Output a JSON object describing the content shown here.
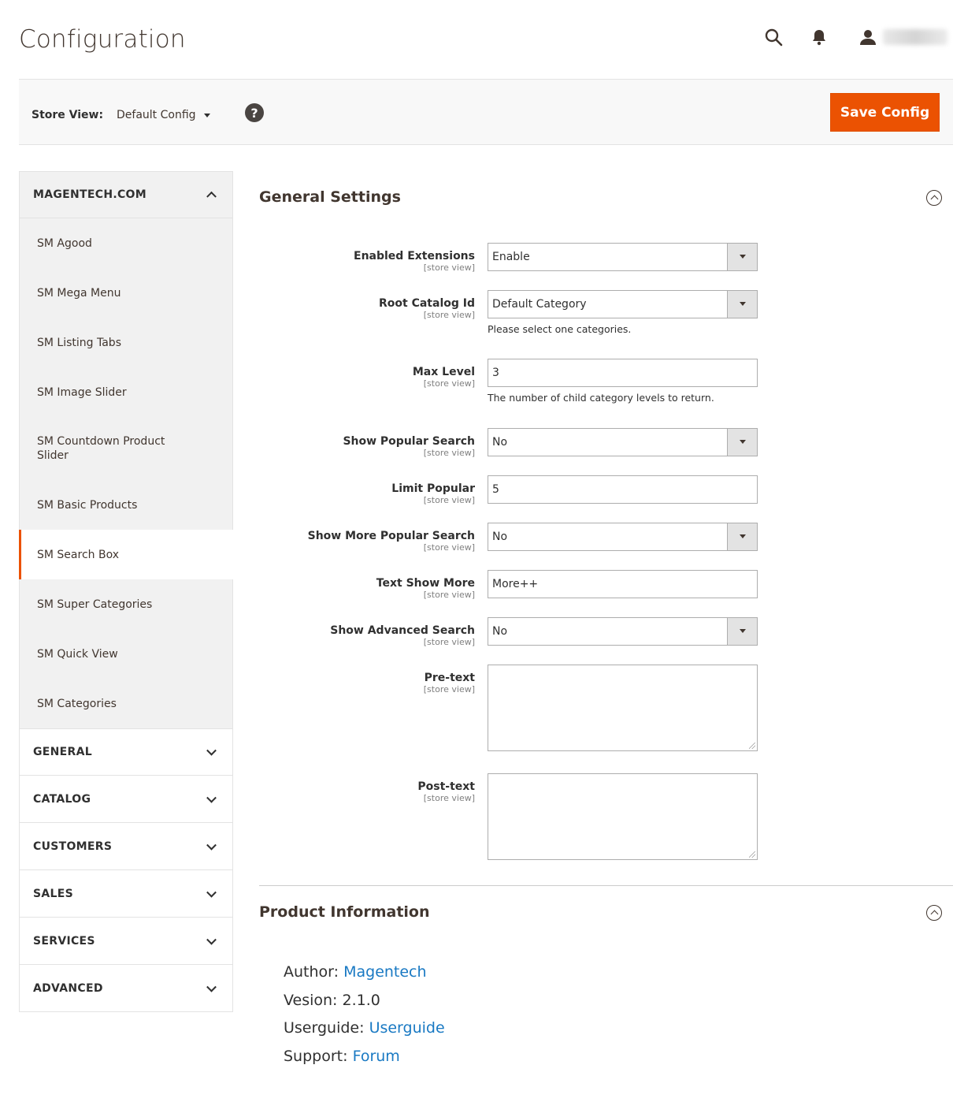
{
  "header": {
    "title": "Configuration",
    "icons": [
      "search-icon",
      "bell-icon",
      "user-icon"
    ]
  },
  "store_bar": {
    "label": "Store View:",
    "selected": "Default Config",
    "help_symbol": "?",
    "save_label": "Save Config"
  },
  "sidebar": {
    "magentech": {
      "label": "MAGENTECH.COM",
      "items": [
        "SM Agood",
        "SM Mega Menu",
        "SM Listing Tabs",
        "SM Image Slider",
        "SM Countdown Product Slider",
        "SM Basic Products",
        "SM Search Box",
        "SM Super Categories",
        "SM Quick View",
        "SM Categories"
      ],
      "active_item": "SM Search Box"
    },
    "groups": [
      "GENERAL",
      "CATALOG",
      "CUSTOMERS",
      "SALES",
      "SERVICES",
      "ADVANCED"
    ]
  },
  "general_settings": {
    "title": "General Settings",
    "scope": "[store view]",
    "fields": {
      "enabled_extensions": {
        "label": "Enabled Extensions",
        "value": "Enable"
      },
      "root_catalog_id": {
        "label": "Root Catalog Id",
        "value": "Default Category",
        "note": "Please select one categories."
      },
      "max_level": {
        "label": "Max Level",
        "value": "3",
        "note": "The number of child category levels to return."
      },
      "show_popular_search": {
        "label": "Show Popular Search",
        "value": "No"
      },
      "limit_popular": {
        "label": "Limit Popular",
        "value": "5"
      },
      "show_more_popular_search": {
        "label": "Show More Popular Search",
        "value": "No"
      },
      "text_show_more": {
        "label": "Text Show More",
        "value": "More++"
      },
      "show_advanced_search": {
        "label": "Show Advanced Search",
        "value": "No"
      },
      "pre_text": {
        "label": "Pre-text",
        "value": ""
      },
      "post_text": {
        "label": "Post-text",
        "value": ""
      }
    }
  },
  "product_information": {
    "title": "Product Information",
    "author_label": "Author:",
    "author_value": "Magentech",
    "version_text": "Vesion: 2.1.0",
    "userguide_label": "Userguide:",
    "userguide_value": "Userguide",
    "support_label": "Support:",
    "support_value": "Forum"
  },
  "colors": {
    "accent": "#eb5202",
    "link": "#1979c3",
    "bar_bg": "#f8f8f8",
    "sidebar_bg": "#f1f1f1"
  }
}
